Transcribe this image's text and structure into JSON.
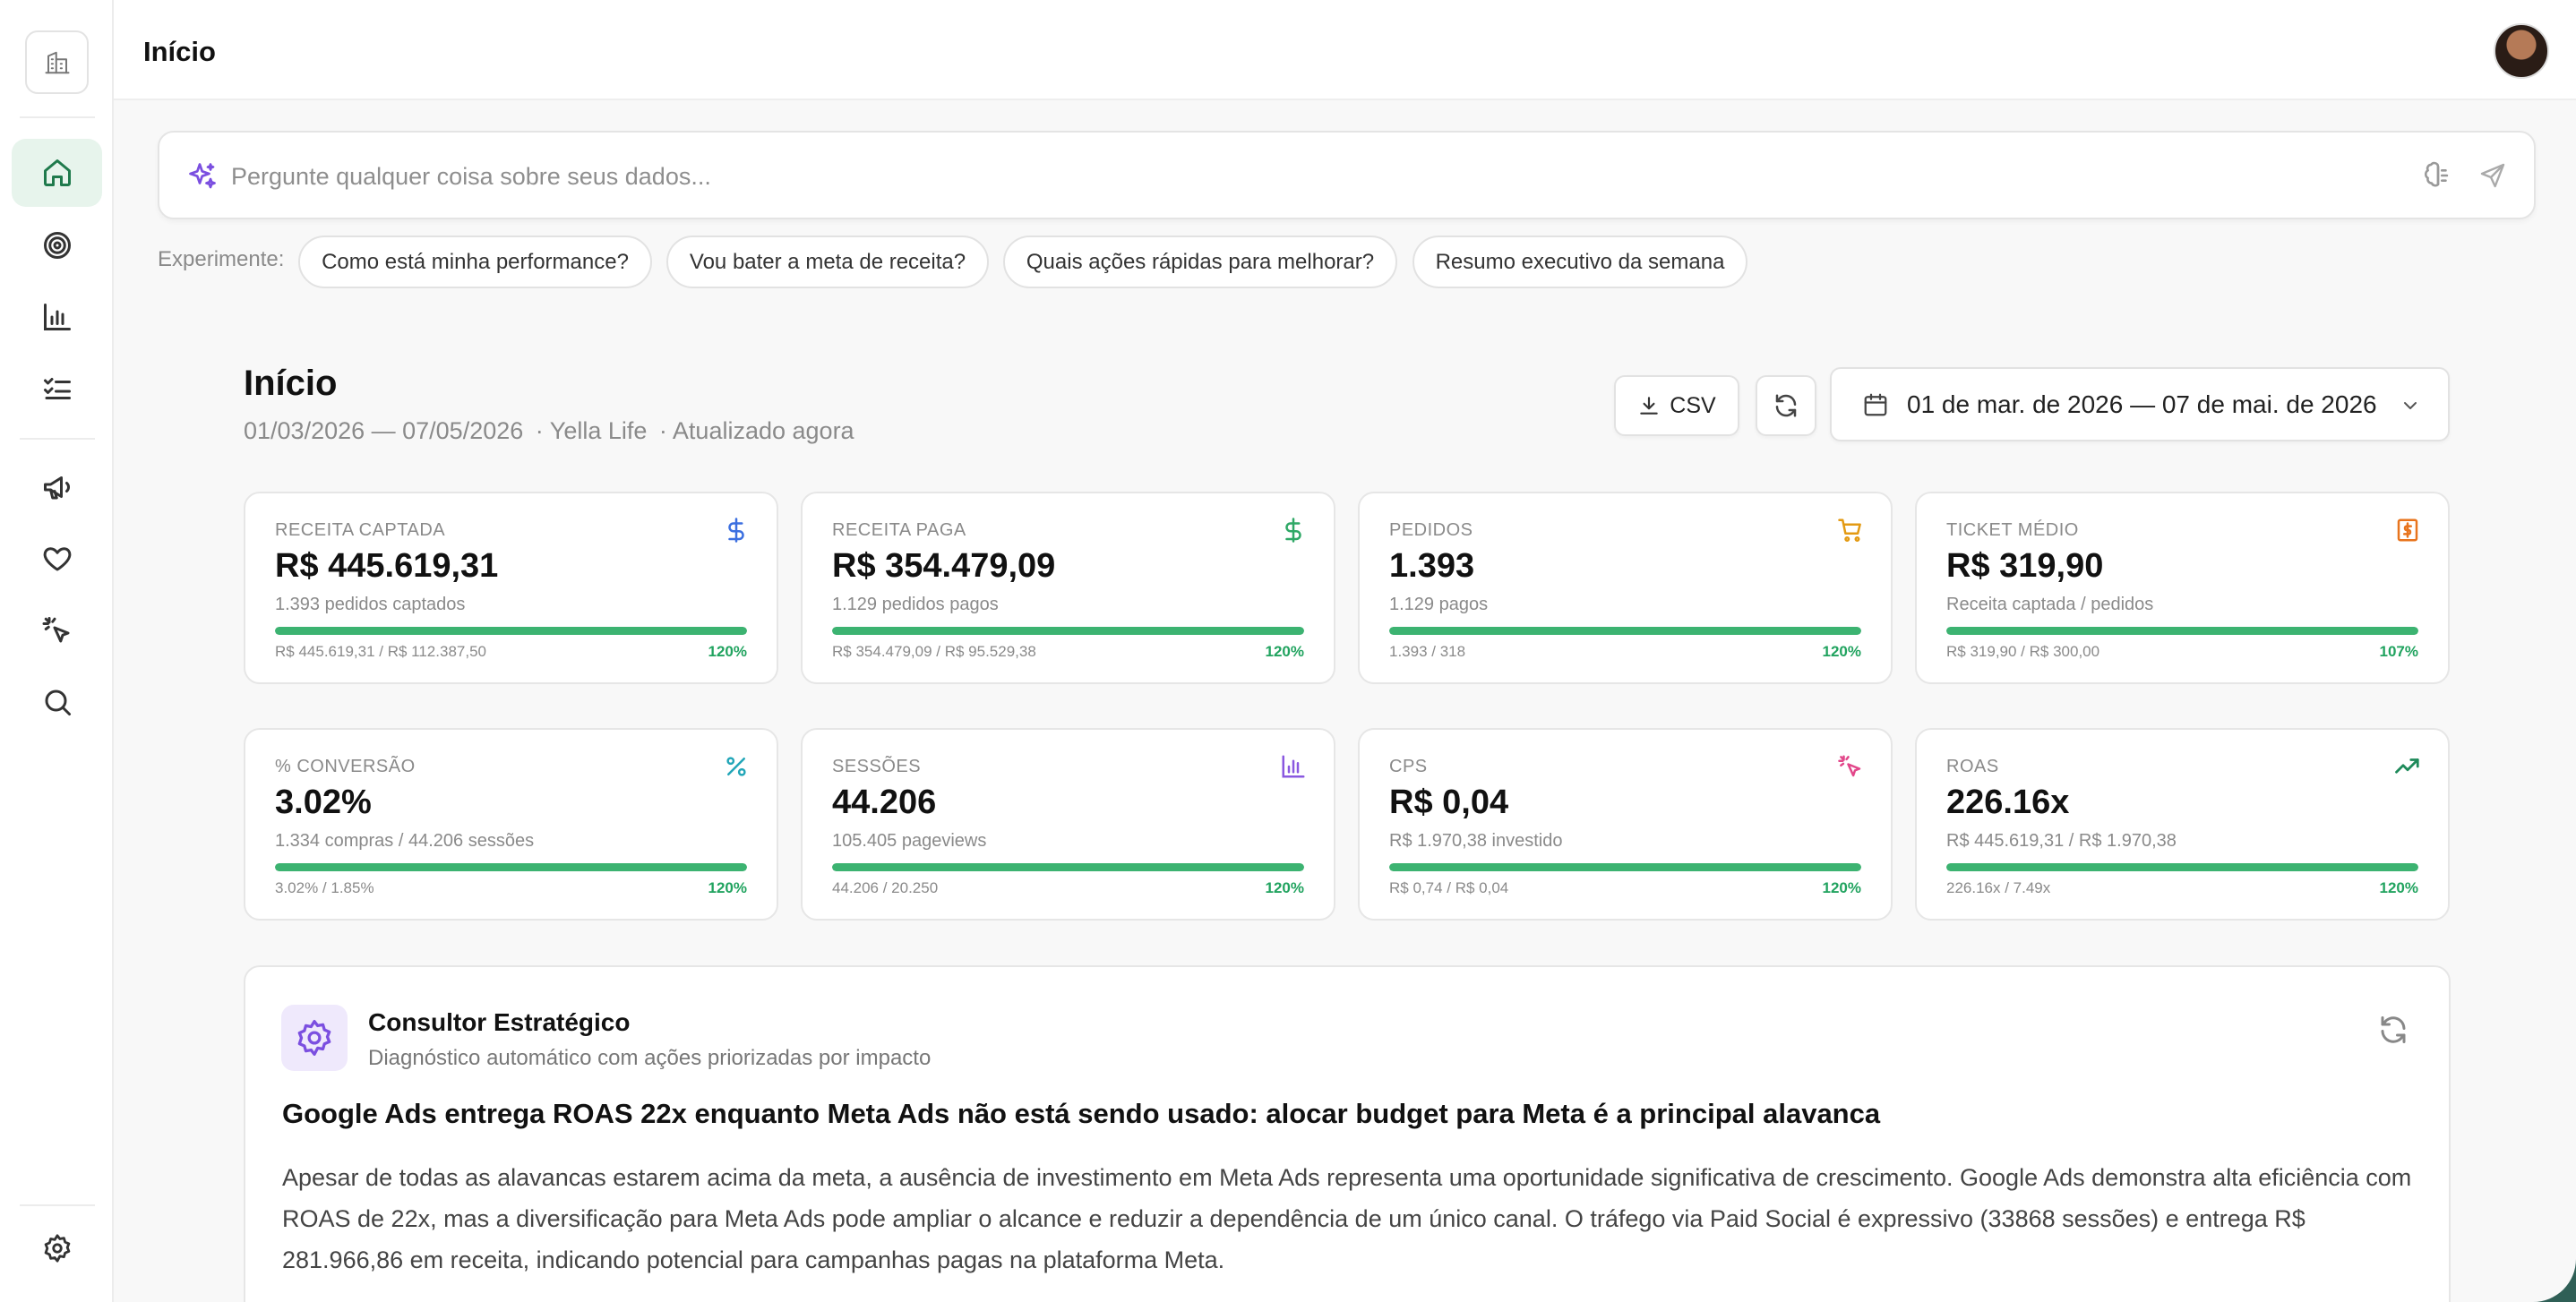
{
  "header": {
    "title": "Início"
  },
  "ask": {
    "placeholder": "Pergunte qualquer coisa sobre seus dados..."
  },
  "suggestions": {
    "label": "Experimente:",
    "chips": [
      "Como está minha performance?",
      "Vou bater a meta de receita?",
      "Quais ações rápidas para melhorar?",
      "Resumo executivo da semana"
    ]
  },
  "page": {
    "title": "Início",
    "date_range": "01/03/2026 — 07/05/2026",
    "store": "· Yella Life",
    "updated": "· Atualizado agora"
  },
  "toolbar": {
    "csv_label": "CSV",
    "date_picker": "01 de mar. de 2026 — 07 de mai. de 2026"
  },
  "metrics": [
    {
      "label": "Receita captada",
      "value": "R$ 445.619,31",
      "sub": "1.393 pedidos captados",
      "ratio": "R$ 445.619,31 / R$ 112.387,50",
      "pct": "120%",
      "progress": 1.0,
      "icon": "dollar-icon",
      "color": "#3b6fe0"
    },
    {
      "label": "Receita paga",
      "value": "R$ 354.479,09",
      "sub": "1.129 pedidos pagos",
      "ratio": "R$ 354.479,09 / R$ 95.529,38",
      "pct": "120%",
      "progress": 1.0,
      "icon": "dollar-icon",
      "color": "#2fa866"
    },
    {
      "label": "Pedidos",
      "value": "1.393",
      "sub": "1.129 pagos",
      "ratio": "1.393 / 318",
      "pct": "120%",
      "progress": 1.0,
      "icon": "cart-icon",
      "color": "#e39a13"
    },
    {
      "label": "Ticket médio",
      "value": "R$ 319,90",
      "sub": "Receita captada / pedidos",
      "ratio": "R$ 319,90 / R$ 300,00",
      "pct": "107%",
      "progress": 1.0,
      "icon": "receipt-icon",
      "color": "#e8741d"
    },
    {
      "label": "% Conversão",
      "value": "3.02%",
      "sub": "1.334 compras / 44.206 sessões",
      "ratio": "3.02% / 1.85%",
      "pct": "120%",
      "progress": 1.0,
      "icon": "percent-icon",
      "color": "#22a6b8"
    },
    {
      "label": "Sessões",
      "value": "44.206",
      "sub": "105.405 pageviews",
      "ratio": "44.206 / 20.250",
      "pct": "120%",
      "progress": 1.0,
      "icon": "bar-chart-icon",
      "color": "#8a58e0"
    },
    {
      "label": "CPS",
      "value": "R$ 0,04",
      "sub": "R$ 1.970,38 investido",
      "ratio": "R$ 0,74 / R$ 0,04",
      "pct": "120%",
      "progress": 1.0,
      "icon": "click-icon",
      "color": "#e2478a"
    },
    {
      "label": "ROAS",
      "value": "226.16x",
      "sub": "R$ 445.619,31 / R$ 1.970,38",
      "ratio": "226.16x / 7.49x",
      "pct": "120%",
      "progress": 1.0,
      "icon": "trending-up-icon",
      "color": "#1e8a5a"
    }
  ],
  "advisor": {
    "title": "Consultor Estratégico",
    "subtitle": "Diagnóstico automático com ações priorizadas por impacto",
    "headline": "Google Ads entrega ROAS 22x enquanto Meta Ads não está sendo usado: alocar budget para Meta é a principal alavanca",
    "body": "Apesar de todas as alavancas estarem acima da meta, a ausência de investimento em Meta Ads representa uma oportunidade significativa de crescimento. Google Ads demonstra alta eficiência com ROAS de 22x, mas a diversificação para Meta Ads pode ampliar o alcance e reduzir a dependência de um único canal. O tráfego via Paid Social é expressivo (33868 sessões) e entrega R$ 281.966,86 em receita, indicando potencial para campanhas pagas na plataforma Meta."
  },
  "colors": {
    "accent": "#3cb371",
    "active_nav_bg": "#e7f4ec",
    "sparkle": "#7b4fe0"
  }
}
